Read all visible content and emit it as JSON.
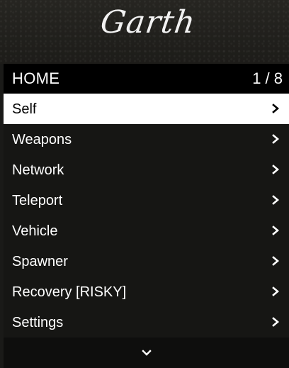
{
  "header": {
    "title": "Garth"
  },
  "subheader": {
    "section": "HOME",
    "counter": "1 / 8"
  },
  "menu": {
    "items": [
      {
        "label": "Self",
        "selected": true
      },
      {
        "label": "Weapons",
        "selected": false
      },
      {
        "label": "Network",
        "selected": false
      },
      {
        "label": "Teleport",
        "selected": false
      },
      {
        "label": "Vehicle",
        "selected": false
      },
      {
        "label": "Spawner",
        "selected": false
      },
      {
        "label": "Recovery [RISKY]",
        "selected": false
      },
      {
        "label": "Settings",
        "selected": false
      }
    ]
  },
  "icons": {
    "item_arrow": "chevron-right-icon",
    "scroll_down": "chevron-down-icon"
  },
  "colors": {
    "selected_bg": "#ffffff",
    "selected_text": "#000000",
    "text": "#ffffff",
    "subheader_bg": "#000000"
  }
}
